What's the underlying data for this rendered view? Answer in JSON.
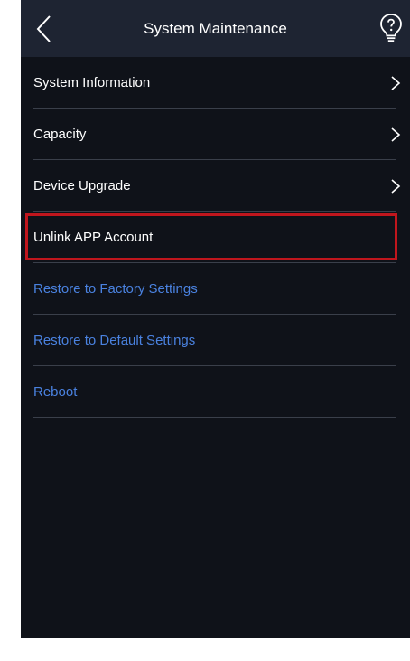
{
  "header": {
    "title": "System Maintenance",
    "back_icon": "chevron-left-icon",
    "help_icon": "lightbulb-question-icon"
  },
  "menu": {
    "items": [
      {
        "label": "System Information",
        "style": "normal",
        "chevron": true
      },
      {
        "label": "Capacity",
        "style": "normal",
        "chevron": true
      },
      {
        "label": "Device Upgrade",
        "style": "normal",
        "chevron": true
      },
      {
        "label": "Unlink APP Account",
        "style": "normal",
        "chevron": false,
        "highlighted": true
      },
      {
        "label": "Restore to Factory Settings",
        "style": "link",
        "chevron": false
      },
      {
        "label": "Restore to Default Settings",
        "style": "link",
        "chevron": false
      },
      {
        "label": "Reboot",
        "style": "link",
        "chevron": false
      }
    ]
  },
  "colors": {
    "background": "#0f1219",
    "header": "#1e2432",
    "link": "#4a82e0",
    "highlight_border": "#c0161d",
    "divider": "#3a3f4a"
  }
}
